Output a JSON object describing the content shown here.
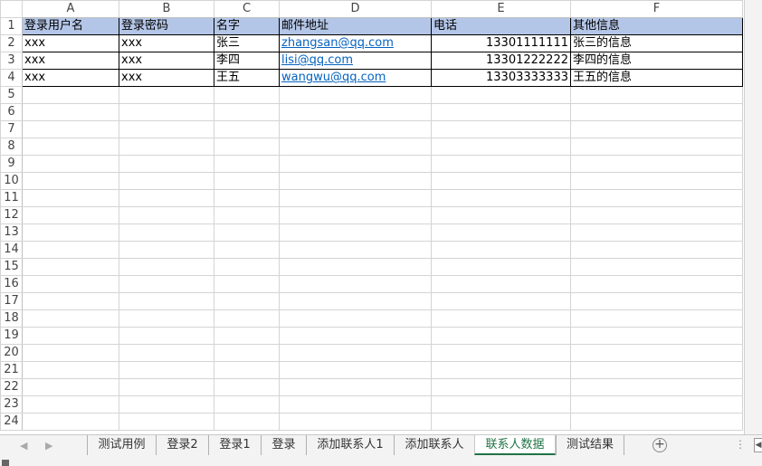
{
  "columns": [
    "A",
    "B",
    "C",
    "D",
    "E",
    "F"
  ],
  "row_numbers": [
    "1",
    "2",
    "3",
    "4",
    "5",
    "6",
    "7",
    "8",
    "9",
    "10",
    "11",
    "12",
    "13",
    "14",
    "15",
    "16",
    "17",
    "18",
    "19",
    "20",
    "21",
    "22",
    "23",
    "24"
  ],
  "header": {
    "a": "登录用户名",
    "b": "登录密码",
    "c": "名字",
    "d": "邮件地址",
    "e": "电话",
    "f": "其他信息"
  },
  "rows": [
    {
      "a": "xxx",
      "b": "xxx",
      "c": "张三",
      "d": "zhangsan@qq.com",
      "e": "13301111111",
      "f": "张三的信息"
    },
    {
      "a": "xxx",
      "b": "xxx",
      "c": "李四",
      "d": "lisi@qq.com",
      "e": "13301222222",
      "f": "李四的信息"
    },
    {
      "a": "xxx",
      "b": "xxx",
      "c": "王五",
      "d": "wangwu@qq.com",
      "e": "13303333333",
      "f": "王五的信息"
    }
  ],
  "tabs": [
    "测试用例",
    "登录2",
    "登录1",
    "登录",
    "添加联系人1",
    "添加联系人",
    "联系人数据",
    "测试结果"
  ],
  "active_tab": "联系人数据",
  "icons": {
    "nav_prev": "chevron-left-icon",
    "nav_next": "chevron-right-icon",
    "add_sheet": "plus-circle-icon",
    "more": "vertical-dots-icon"
  },
  "colors": {
    "header_fill": "#b4c6e7",
    "link": "#0563c1",
    "active_tab": "#217346"
  }
}
